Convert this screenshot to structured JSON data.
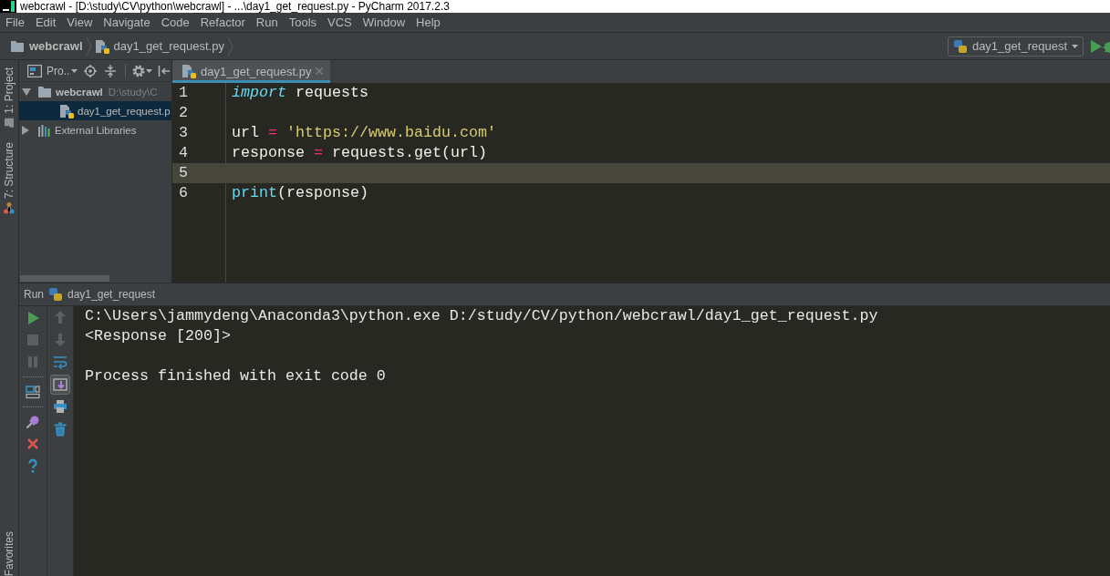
{
  "window": {
    "title": "webcrawl - [D:\\study\\CV\\python\\webcrawl] - ...\\day1_get_request.py - PyCharm 2017.2.3"
  },
  "menu": [
    "File",
    "Edit",
    "View",
    "Navigate",
    "Code",
    "Refactor",
    "Run",
    "Tools",
    "VCS",
    "Window",
    "Help"
  ],
  "navbar": {
    "breadcrumbs": [
      {
        "kind": "folder",
        "label": "webcrawl"
      },
      {
        "kind": "python",
        "label": "day1_get_request.py"
      }
    ],
    "run_configuration": "day1_get_request"
  },
  "tool_strip": {
    "tabs": [
      {
        "kind": "project",
        "label": "1: Project"
      },
      {
        "kind": "structure",
        "label": "7: Structure"
      }
    ],
    "bottom_tabs": [
      {
        "label": "Favorites"
      }
    ]
  },
  "project": {
    "view": "Pro..",
    "tree": [
      {
        "kind": "folder",
        "label": "webcrawl",
        "path": "D:\\study\\C",
        "expanded": true,
        "selected": false,
        "children": [
          {
            "kind": "python",
            "label": "day1_get_request.p",
            "selected": true
          }
        ]
      },
      {
        "kind": "library",
        "label": "External Libraries",
        "expanded": false,
        "selected": false
      }
    ]
  },
  "editor": {
    "tabs": [
      {
        "label": "day1_get_request.py",
        "selected": true
      }
    ],
    "lines": [
      {
        "number": "1",
        "current": false,
        "tokens": [
          {
            "kind": "keyword",
            "text": "import"
          },
          {
            "kind": "plain",
            "text": " requests"
          }
        ]
      },
      {
        "number": "2",
        "current": false
      },
      {
        "number": "3",
        "current": false,
        "tokens": [
          {
            "kind": "plain",
            "text": "url "
          },
          {
            "kind": "operator",
            "text": "="
          },
          {
            "kind": "string",
            "text": " 'https://www.baidu.com'"
          }
        ]
      },
      {
        "number": "4",
        "current": false,
        "tokens": [
          {
            "kind": "plain",
            "text": "response "
          },
          {
            "kind": "operator",
            "text": "="
          },
          {
            "kind": "plain",
            "text": " requests.get(url)"
          }
        ]
      },
      {
        "number": "5",
        "current": true
      },
      {
        "number": "6",
        "current": false,
        "tokens": [
          {
            "kind": "builtin",
            "text": "print"
          },
          {
            "kind": "plain",
            "text": "(response)"
          }
        ]
      }
    ]
  },
  "run": {
    "title": "Run",
    "configuration": "day1_get_request",
    "tool_columns": [
      {
        "groups": [
          {
            "tools": [
              {
                "kind": "run",
                "disabled": false,
                "on": false
              },
              {
                "kind": "stop",
                "disabled": true,
                "on": false
              },
              {
                "kind": "pause",
                "disabled": true,
                "on": false
              }
            ]
          },
          {
            "tools": [
              {
                "kind": "layout",
                "disabled": false,
                "on": false
              }
            ]
          },
          {
            "tools": [
              {
                "kind": "pin",
                "disabled": false,
                "on": false
              },
              {
                "kind": "close",
                "disabled": false,
                "on": false
              },
              {
                "kind": "help",
                "disabled": false,
                "on": false
              }
            ]
          }
        ]
      },
      {
        "groups": [
          {
            "tools": [
              {
                "kind": "up",
                "disabled": true,
                "on": false
              },
              {
                "kind": "down",
                "disabled": true,
                "on": false
              },
              {
                "kind": "wrap",
                "disabled": false,
                "on": false
              },
              {
                "kind": "scroll_end",
                "disabled": false,
                "on": true
              },
              {
                "kind": "print",
                "disabled": false,
                "on": false
              },
              {
                "kind": "trash",
                "disabled": false,
                "on": false
              }
            ]
          }
        ]
      }
    ],
    "console": [
      {
        "kind": "command",
        "text": "C:\\Users\\jammydeng\\Anaconda3\\python.exe D:/study/CV/python/webcrawl/day1_get_request.py"
      },
      {
        "kind": "output",
        "text": "<Response [200]>"
      },
      {
        "kind": "exit",
        "text": "Process finished with exit code 0"
      }
    ]
  }
}
